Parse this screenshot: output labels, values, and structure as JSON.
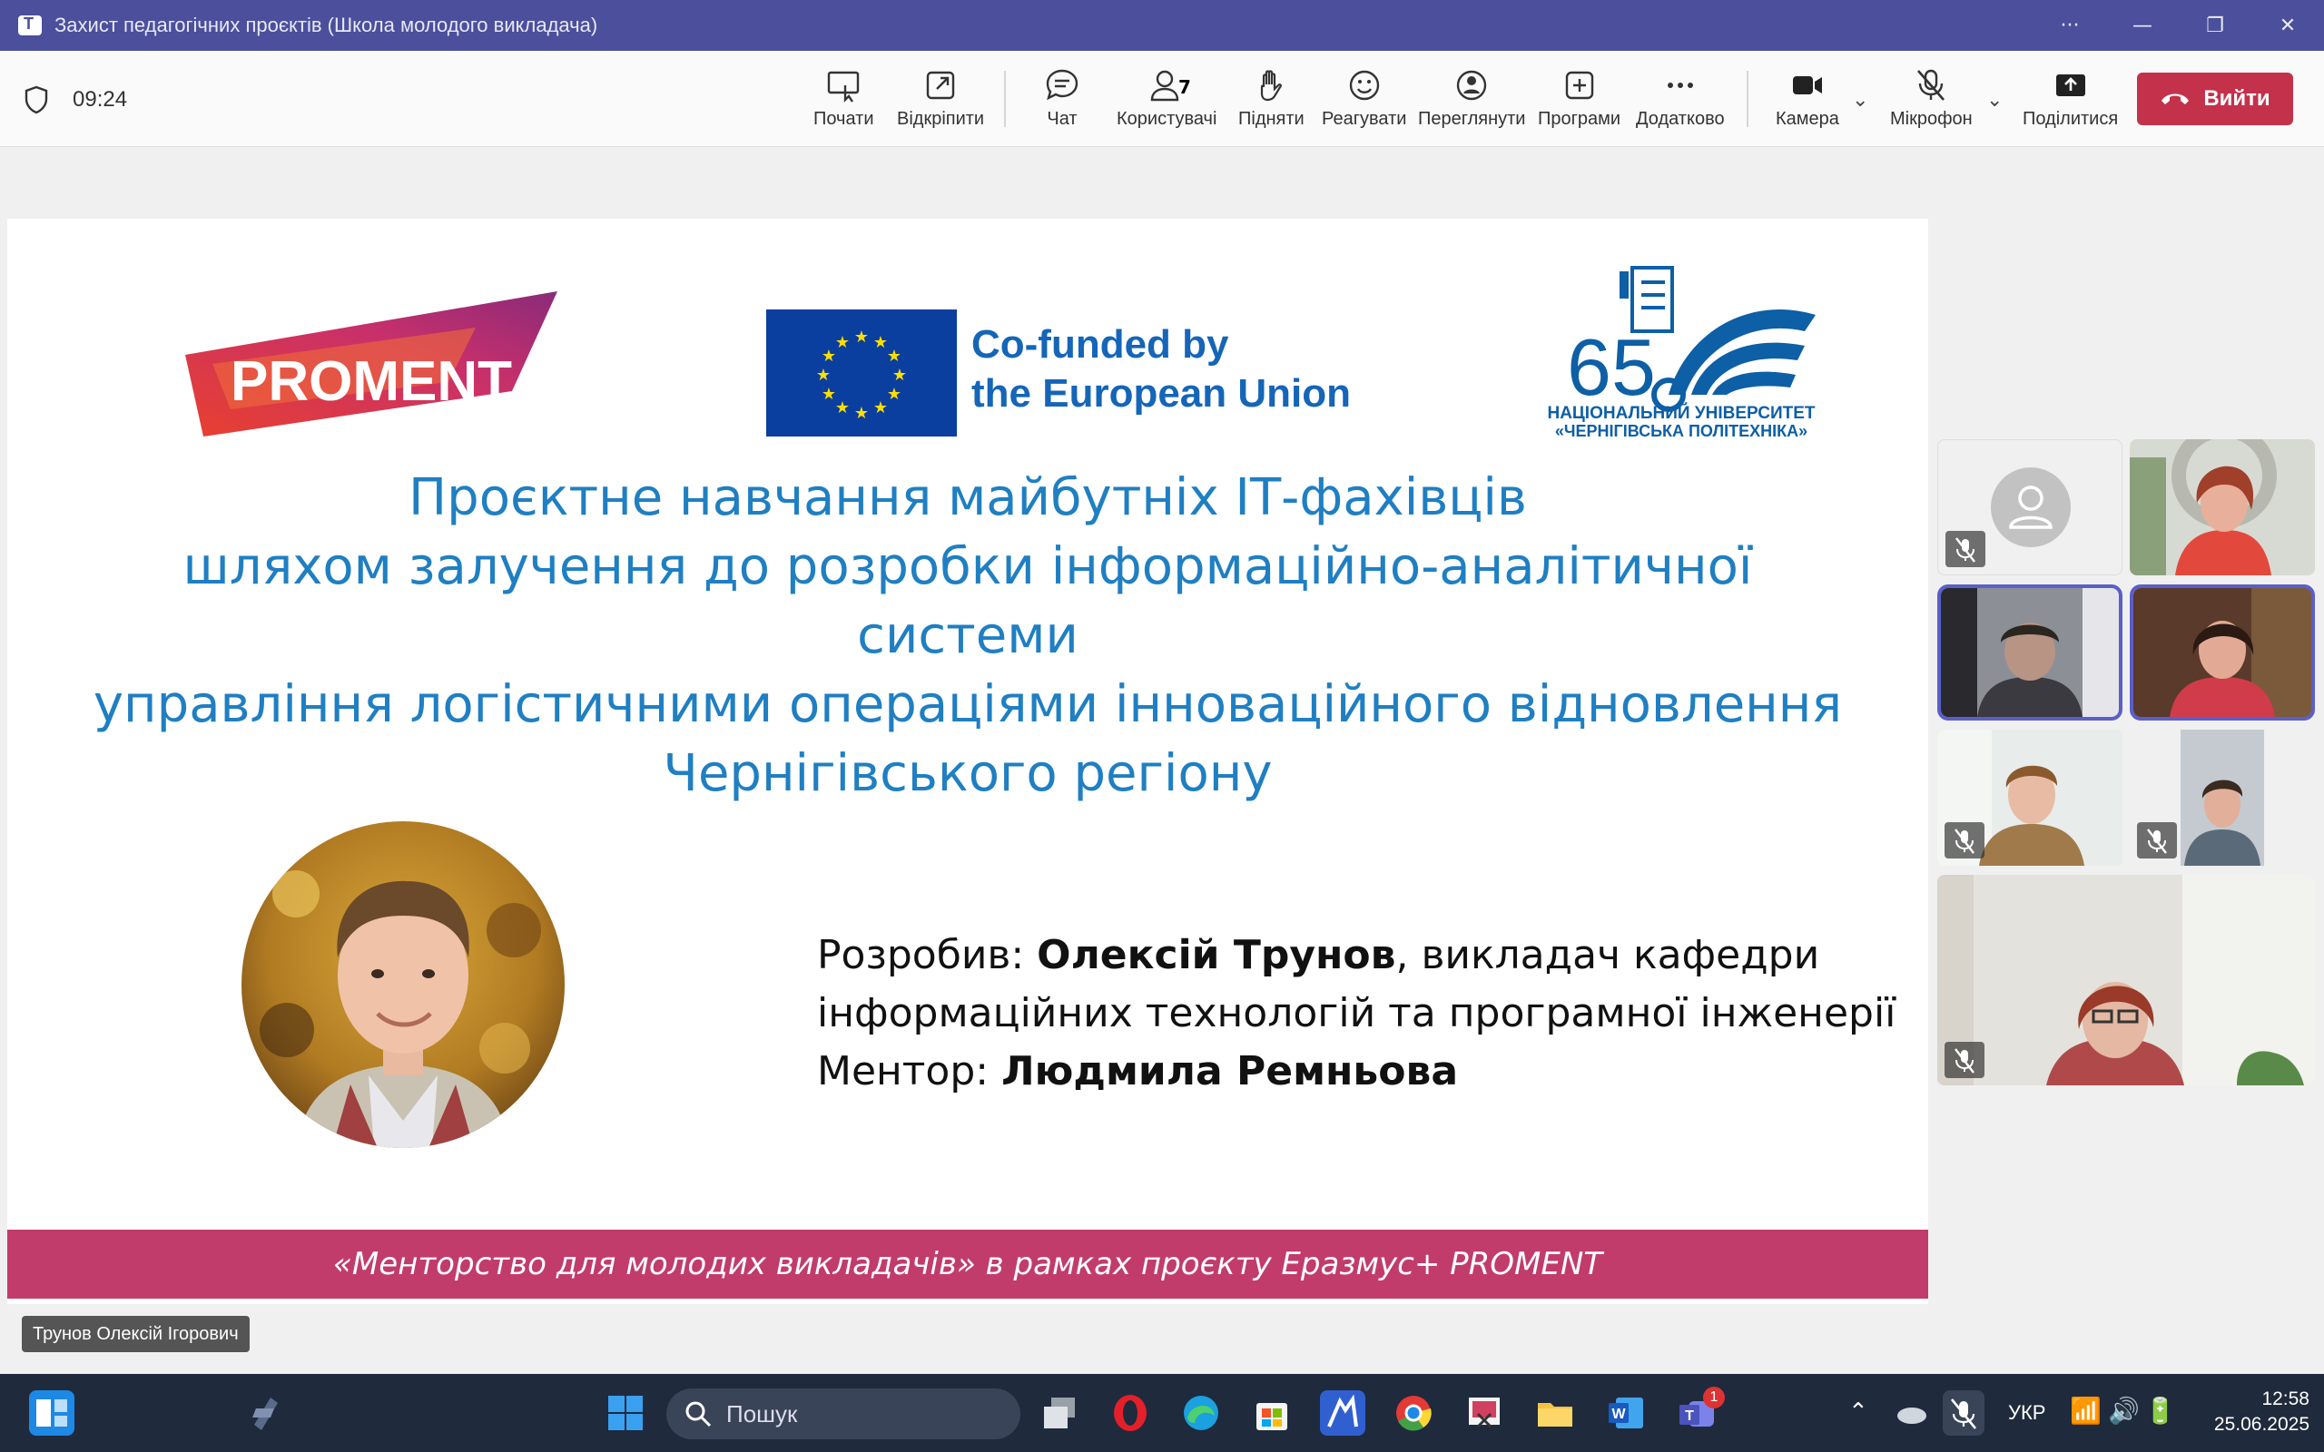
{
  "window": {
    "title": "Захист педагогічних проєктів (Школа молодого викладача)"
  },
  "meeting": {
    "elapsed": "09:24",
    "participants_count": "7",
    "toolbar": {
      "start": "Почати",
      "popout": "Відкріпити",
      "chat": "Чат",
      "people": "Користувачі",
      "raise": "Підняти",
      "react": "Реагувати",
      "view": "Переглянути",
      "apps": "Програми",
      "more": "Додатково",
      "camera": "Камера",
      "mic": "Мікрофон",
      "share": "Поділитися",
      "leave": "Вийти"
    },
    "speaker_name": "Трунов Олексій Ігорович"
  },
  "slide": {
    "eu_line1": "Co-funded by",
    "eu_line2": "the European Union",
    "uni_line1": "НАЦІОНАЛЬНИЙ УНІВЕРСИТЕТ",
    "uni_line2": "«ЧЕРНІГІВСЬКА ПОЛІТЕХНІКА»",
    "uni_number": "65",
    "title_lines": [
      "Проєктне навчання майбутніх ІТ-фахівців",
      "шляхом залучення до  розробки  інформаційно-аналітичної",
      "системи",
      "управління логістичними операціями інноваційного відновлення",
      "Чернігівського регіону"
    ],
    "developed_label": "Розробив: ",
    "developer_name": "Олексій Трунов",
    "developer_role_1": ", викладач кафедри",
    "developer_role_2": "інформаційних технологій та програмної інженерії",
    "mentor_label": "Ментор: ",
    "mentor_name": "Людмила Ремньова",
    "footer": "«Менторство для молодих викладачів» в рамках проєкту Еразмус+ PROMENT",
    "proment_logo_text": "PROMENT"
  },
  "taskbar": {
    "search_placeholder": "Пошук",
    "language": "УКР",
    "time": "12:58",
    "date": "25.06.2025",
    "teams_badge": "1"
  },
  "colors": {
    "teams_purple": "#4b4f9c",
    "leave_red": "#c4314b",
    "slide_blue": "#1f7fc2",
    "footer_pink": "#c13c6a"
  }
}
